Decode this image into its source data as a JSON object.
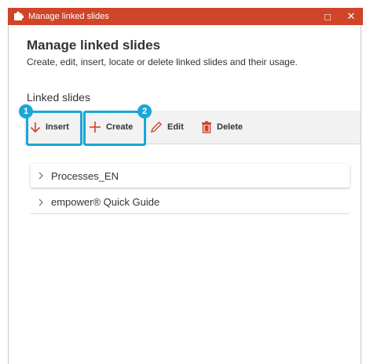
{
  "window": {
    "title": "Manage linked slides",
    "maximize_symbol": "□",
    "close_symbol": "✕",
    "app_icon": "puzzle-piece-icon"
  },
  "header": {
    "title": "Manage linked slides",
    "subtitle": "Create, edit, insert, locate or delete linked slides and their usage."
  },
  "section": {
    "label": "Linked slides"
  },
  "toolbar": {
    "insert_label": "Insert",
    "create_label": "Create",
    "edit_label": "Edit",
    "delete_label": "Delete"
  },
  "callouts": {
    "first": "1",
    "second": "2"
  },
  "tree": {
    "items": [
      {
        "label": "Processes_EN",
        "selected": true
      },
      {
        "label": "empower® Quick Guide",
        "selected": false
      }
    ]
  },
  "colors": {
    "titlebar": "#d0442a",
    "accent": "#d0442a",
    "callout": "#1ba6d6"
  }
}
